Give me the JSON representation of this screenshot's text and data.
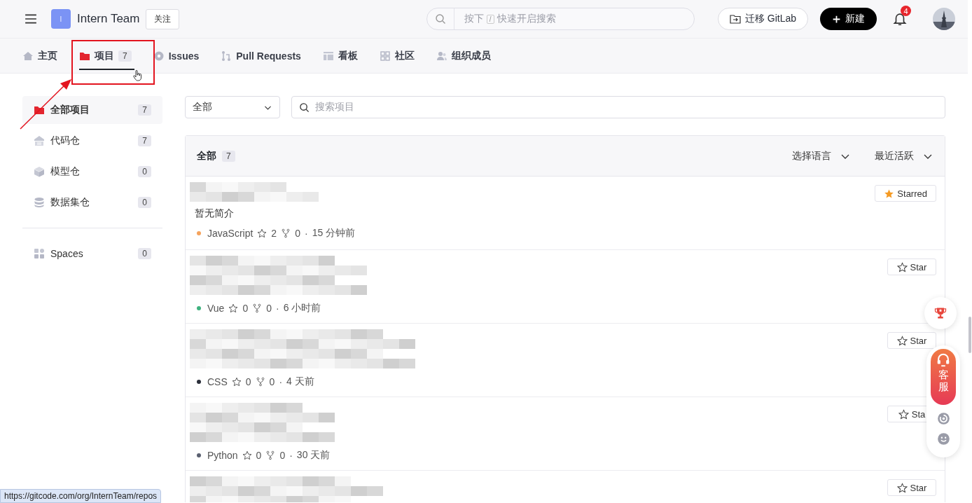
{
  "header": {
    "logo_letter": "I",
    "org_name": "Intern Team",
    "follow_button": "关注",
    "search": {
      "prefix": "按下",
      "key": "/",
      "placeholder": "快速开启搜索"
    },
    "migrate_button": "迁移 GitLab",
    "new_button": "新建",
    "notification_count": "4"
  },
  "tabs": [
    {
      "label": "主页",
      "selected": false
    },
    {
      "label": "项目",
      "count": "7",
      "selected": true
    },
    {
      "label": "Issues",
      "selected": false
    },
    {
      "label": "Pull Requests",
      "selected": false
    },
    {
      "label": "看板",
      "selected": false
    },
    {
      "label": "社区",
      "selected": false
    },
    {
      "label": "组织成员",
      "selected": false
    }
  ],
  "sidebar": {
    "items": [
      {
        "label": "全部项目",
        "count": "7",
        "selected": true
      },
      {
        "label": "代码仓",
        "count": "7",
        "selected": false
      },
      {
        "label": "模型仓",
        "count": "0",
        "selected": false
      },
      {
        "label": "数据集仓",
        "count": "0",
        "selected": false
      }
    ],
    "extra_items": [
      {
        "label": "Spaces",
        "count": "0",
        "selected": false
      }
    ]
  },
  "filter": {
    "select_value": "全部",
    "search_placeholder": "搜索项目"
  },
  "list": {
    "title": "全部",
    "count": "7",
    "language_filter": "选择语言",
    "sort": "最近活跃",
    "repos": [
      {
        "description": "暂无简介",
        "starred": true,
        "star_label": "Starred",
        "language": "JavaScript",
        "color": "#f5a35c",
        "stars": "2",
        "forks": "0",
        "separator": "·",
        "updated": "15 分钟前"
      },
      {
        "starred": false,
        "star_label": "Star",
        "language": "Vue",
        "color": "#3fb27f",
        "stars": "0",
        "forks": "0",
        "separator": "·",
        "updated": "6 小时前"
      },
      {
        "starred": false,
        "star_label": "Star",
        "language": "CSS",
        "color": "#2b2f3a",
        "stars": "0",
        "forks": "0",
        "separator": "·",
        "updated": "4 天前"
      },
      {
        "starred": false,
        "star_label": "Sta",
        "language": "Python",
        "color": "#5a6070",
        "stars": "0",
        "forks": "0",
        "separator": "·",
        "updated": "30 天前"
      },
      {
        "starred": false,
        "star_label": "Star"
      }
    ]
  },
  "float_widget": {
    "service_label": "客服"
  },
  "status_url": "https://gitcode.com/org/InternTeam/repos"
}
